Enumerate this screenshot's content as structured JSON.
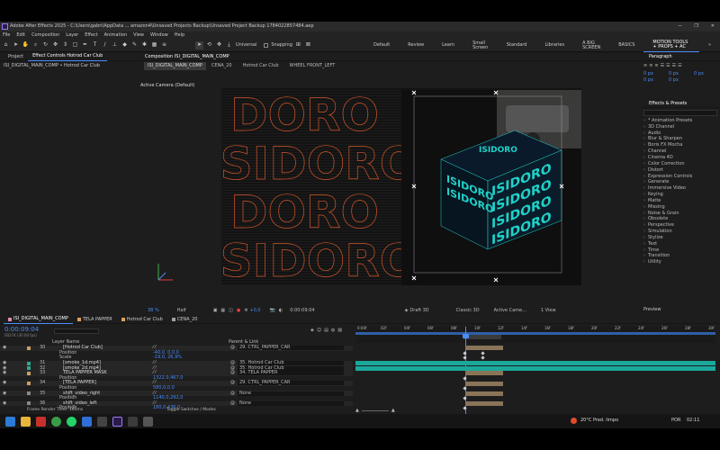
{
  "window": {
    "title": "Adobe After Effects 2025 - C:\\Users\\gabri\\AppData ... amazon4\\Unsaved Projects Backup\\Unsaved Project Backup 1784022857484.aep",
    "controls": {
      "minimize": "—",
      "maximize": "❐",
      "close": "✕"
    }
  },
  "menu": [
    "File",
    "Edit",
    "Composition",
    "Layer",
    "Effect",
    "Animation",
    "View",
    "Window",
    "Help"
  ],
  "toolbar": {
    "universal_label": "Universal",
    "snapping_label": "Snapping",
    "workspaces": [
      "Default",
      "Review",
      "Learn",
      "Small Screen",
      "Standard",
      "Libraries",
      "A BIG SCREEN",
      "BASICS",
      "MOTION TOOLS + PROPS + AC"
    ],
    "active_workspace": "MOTION TOOLS + PROPS + AC",
    "overflow": "»"
  },
  "project_panel": {
    "tabs": [
      "Project",
      "Effect Controls Hotrod Car Club"
    ],
    "path": "ISI_DIGITAL_MAIN_COMP • Hotrod Car Club"
  },
  "comp_panel": {
    "tab": "Composition ISI_DIGITAL_MAIN_COMP",
    "flow_tabs": [
      "ISI_DIGITAL_MAIN_COMP",
      "CENA_20",
      "Hotrod Car Club",
      "WHEEL FRONT_LEFT"
    ],
    "camera_label": "Active Camera (Default)",
    "zoom": "38 %",
    "quality": "Half",
    "time": "0:00:09:04",
    "exposure": "+0,0",
    "renderer": "Draft 3D",
    "renderer_mode": "Classic 3D",
    "view_camera": "Active Came...",
    "views": "1 View",
    "artwork_word": "ISIDORO",
    "bg_word": "DORO"
  },
  "paragraph_panel": {
    "title": "Paragraph",
    "values": [
      "0 px",
      "0 px",
      "0 px",
      "0 px",
      "0 px"
    ]
  },
  "effects_panel": {
    "title": "Effects & Presets",
    "search_placeholder": "",
    "items": [
      "* Animation Presets",
      "3D Channel",
      "Audio",
      "Blur & Sharpen",
      "Boris FX Mocha",
      "Channel",
      "Cinema 4D",
      "Color Correction",
      "Distort",
      "Expression Controls",
      "Generate",
      "Immersive Video",
      "Keying",
      "Matte",
      "Missing",
      "Noise & Grain",
      "Obsolete",
      "Perspective",
      "Simulation",
      "Stylize",
      "Text",
      "Time",
      "Transition",
      "Utility"
    ],
    "preview_label": "Preview"
  },
  "timeline": {
    "tabs": [
      "ISI_DIGITAL_MAIN_COMP",
      "TELA PAPPER",
      "Hotrod Car Club",
      "CENA_20"
    ],
    "current_time": "0:00:09:04",
    "fps_line": "00274 (30.00 fps)",
    "search_placeholder": "",
    "col_layer_name": "Layer Name",
    "col_parent": "Parent & Link",
    "ruler": [
      "0:00f",
      "02f",
      "04f",
      "06f",
      "08f",
      "10f",
      "12f",
      "14f",
      "16f",
      "18f",
      "20f",
      "22f",
      "24f",
      "26f",
      "28f",
      "30f"
    ],
    "rows": [
      {
        "num": "30",
        "name": "[Hotrod Car Club]",
        "value": "",
        "parent": "29. CTRL_PAPPER_CAR",
        "type": "layer"
      },
      {
        "num": "",
        "name": "Position",
        "value": "-40,0, 0,0,0",
        "parent": "",
        "type": "prop"
      },
      {
        "num": "",
        "name": "Scale",
        "value": "-19,0, 26,9%",
        "parent": "",
        "type": "prop"
      },
      {
        "num": "31",
        "name": "[smoke_1d.mp4]",
        "value": "",
        "parent": "35. Hotrod Car Club",
        "type": "layer"
      },
      {
        "num": "32",
        "name": "[smoke_2d.mp4]",
        "value": "",
        "parent": "35. Hotrod Car Club",
        "type": "layer"
      },
      {
        "num": "33",
        "name": "TELA PAPPER MASK",
        "value": "",
        "parent": "34. TELA PAPPER",
        "type": "layer"
      },
      {
        "num": "",
        "name": "Position",
        "value": "1322,0,467,0",
        "parent": "",
        "type": "prop"
      },
      {
        "num": "34",
        "name": "[TELA PAPPER]",
        "value": "",
        "parent": "29. CTRL_PAPPER_CAR",
        "type": "layer"
      },
      {
        "num": "",
        "name": "Position",
        "value": "580,0,0,0",
        "parent": "",
        "type": "prop"
      },
      {
        "num": "35",
        "name": "shift_video_right",
        "value": "",
        "parent": "None",
        "type": "layer"
      },
      {
        "num": "",
        "name": "Position",
        "value": "1140,0,292,0",
        "parent": "",
        "type": "prop"
      },
      {
        "num": "36",
        "name": "shift_video_left",
        "value": "",
        "parent": "None",
        "type": "layer"
      },
      {
        "num": "",
        "name": "Position",
        "value": "180,0,436,0",
        "parent": "",
        "type": "prop"
      }
    ],
    "footer_left": "Frame Render Time: 160ms",
    "footer_center": "Toggle Switches / Modes"
  },
  "taskbar": {
    "weather": "20°C  Pred. limpo",
    "lang": "POR",
    "time": "02:11"
  },
  "colors": {
    "accent": "#4a8cf7",
    "teal": "#1aa89a",
    "tan": "#8a7458",
    "orange": "#e07a2f",
    "cube": "#1fd2c8"
  }
}
